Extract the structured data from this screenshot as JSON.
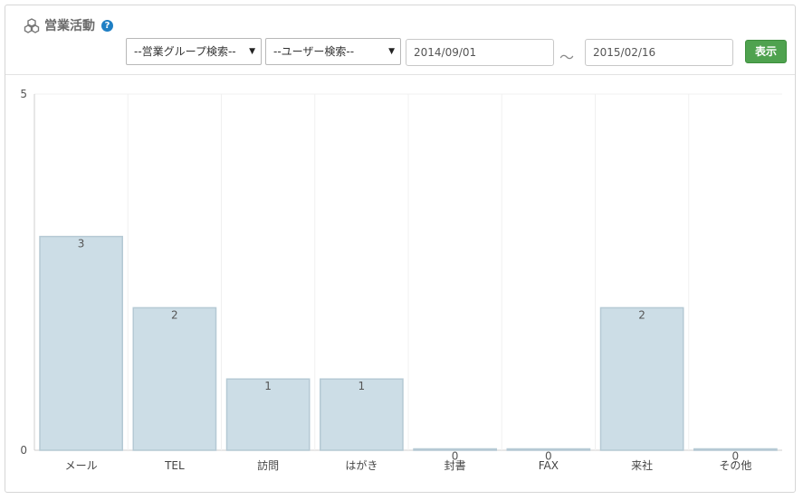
{
  "header": {
    "title": "営業活動",
    "help_label": "?",
    "group_select": "--営業グループ検索--",
    "user_select": "--ユーザー検索--",
    "date_from": "2014/09/01",
    "date_separator": "～",
    "date_to": "2015/02/16",
    "show_button": "表示"
  },
  "colors": {
    "bar_fill": "#ccdde6",
    "bar_stroke": "#b5c9d4",
    "button": "#4fa24f",
    "help_icon": "#1f7fc4"
  },
  "chart_data": {
    "type": "bar",
    "categories": [
      "メール",
      "TEL",
      "訪問",
      "はがき",
      "封書",
      "FAX",
      "来社",
      "その他"
    ],
    "values": [
      3,
      2,
      1,
      1,
      0,
      0,
      2,
      0
    ],
    "data_labels": [
      "3",
      "2",
      "1",
      "1",
      "0",
      "0",
      "2",
      "0"
    ],
    "yticks": [
      "0",
      "5"
    ],
    "ylim": [
      0,
      5
    ],
    "grid": true,
    "legend": "none"
  }
}
